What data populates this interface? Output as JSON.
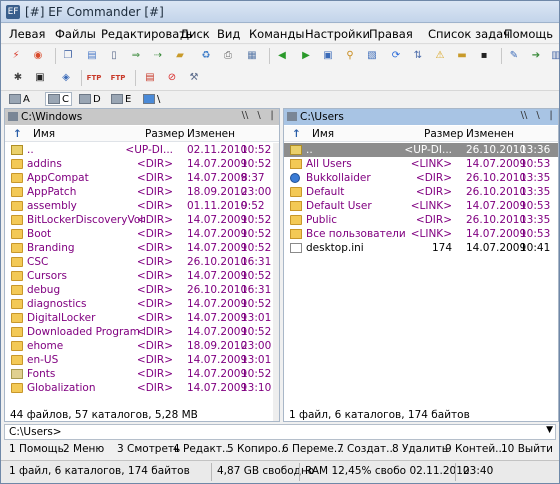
{
  "window": {
    "title": "[#] EF Commander [#]",
    "app_icon": "EF"
  },
  "menu": [
    "Левая",
    "Файлы",
    "Редактировать",
    "Диск",
    "Вид",
    "Команды",
    "Настройки",
    "Правая",
    "Список задач",
    "Помощь"
  ],
  "toolbar1_icons": [
    {
      "name": "lightning-icon",
      "glyph": "⚡",
      "color": "#d83a2a"
    },
    {
      "name": "stop-icon",
      "glyph": "◉",
      "color": "#d84a2a"
    },
    {
      "name": "copy-icon",
      "glyph": "❐",
      "color": "#4a6aa8"
    },
    {
      "name": "book-icon",
      "glyph": "▤",
      "color": "#4a7ac8"
    },
    {
      "name": "new-file-icon",
      "glyph": "▯",
      "color": "#5a6a8a"
    },
    {
      "name": "copy-files-icon",
      "glyph": "⇒",
      "color": "#3a8a3a"
    },
    {
      "name": "move-files-icon",
      "glyph": "⇢",
      "color": "#3a8a3a"
    },
    {
      "name": "new-folder-icon",
      "glyph": "▰",
      "color": "#c89a2a"
    },
    {
      "name": "delete-icon",
      "glyph": "♻",
      "color": "#3a7ac8"
    },
    {
      "name": "print-icon",
      "glyph": "⎙",
      "color": "#6a6a6a"
    },
    {
      "name": "properties-icon",
      "glyph": "▦",
      "color": "#5a7aa8"
    },
    {
      "name": "back-icon",
      "glyph": "◀",
      "color": "#2a9a2a"
    },
    {
      "name": "forward-icon",
      "glyph": "▶",
      "color": "#2a9a2a"
    },
    {
      "name": "filter-icon",
      "glyph": "▣",
      "color": "#3a6ab8"
    },
    {
      "name": "search-icon",
      "glyph": "⚲",
      "color": "#c88a1a"
    },
    {
      "name": "find-icon",
      "glyph": "▧",
      "color": "#3a6ab8"
    },
    {
      "name": "sync-icon",
      "glyph": "⟳",
      "color": "#2a6ad8"
    },
    {
      "name": "sort-icon",
      "glyph": "⇅",
      "color": "#4a6aa8"
    },
    {
      "name": "warning-icon",
      "glyph": "⚠",
      "color": "#d8a21a"
    },
    {
      "name": "folder-icon",
      "glyph": "▬",
      "color": "#c89a2a"
    },
    {
      "name": "console-icon",
      "glyph": "▪",
      "color": "#222222"
    },
    {
      "name": "edit-icon",
      "glyph": "✎",
      "color": "#3a6ab8"
    },
    {
      "name": "arrow-right-icon",
      "glyph": "➔",
      "color": "#3a8a3a"
    },
    {
      "name": "view-icon",
      "glyph": "▥",
      "color": "#4a6aa8"
    }
  ],
  "toolbar2_icons": [
    {
      "name": "network-icon",
      "glyph": "✱",
      "color": "#444444"
    },
    {
      "name": "terminal-icon",
      "glyph": "▣",
      "color": "#222222"
    },
    {
      "name": "cube-icon",
      "glyph": "◈",
      "color": "#3a6ab8"
    },
    {
      "name": "ftp-connect-icon",
      "glyph": "FTP",
      "color": "#c83a2a"
    },
    {
      "name": "ftp-disconnect-icon",
      "glyph": "FTP",
      "color": "#c83a2a"
    },
    {
      "name": "pack-icon",
      "glyph": "▤",
      "color": "#c83a2a"
    },
    {
      "name": "close-circle-icon",
      "glyph": "⊘",
      "color": "#d82a2a"
    },
    {
      "name": "tools-icon",
      "glyph": "⚒",
      "color": "#5a6a8a"
    }
  ],
  "drives": [
    "A",
    "C",
    "D",
    "E",
    "\\"
  ],
  "left_panel": {
    "path": "C:\\Windows",
    "col_name": "Имя",
    "col_size": "Размер",
    "col_date": "Изменен",
    "rows": [
      {
        "icon": "up",
        "name": "..",
        "size": "<UP-DI...",
        "date": "02.11.2010",
        "time": "10:52",
        "purple": true
      },
      {
        "icon": "folder",
        "name": "addins",
        "size": "<DIR>",
        "date": "14.07.2009",
        "time": "10:52",
        "purple": true
      },
      {
        "icon": "folder",
        "name": "AppCompat",
        "size": "<DIR>",
        "date": "14.07.2009",
        "time": "8:37",
        "purple": true
      },
      {
        "icon": "folder",
        "name": "AppPatch",
        "size": "<DIR>",
        "date": "18.09.2010",
        "time": "23:00",
        "purple": true
      },
      {
        "icon": "folder",
        "name": "assembly",
        "size": "<DIR>",
        "date": "01.11.2010",
        "time": "9:52",
        "purple": true
      },
      {
        "icon": "folder",
        "name": "BitLockerDiscoveryVolu...",
        "size": "<DIR>",
        "date": "14.07.2009",
        "time": "10:52",
        "purple": true
      },
      {
        "icon": "folder",
        "name": "Boot",
        "size": "<DIR>",
        "date": "14.07.2009",
        "time": "10:52",
        "purple": true
      },
      {
        "icon": "folder",
        "name": "Branding",
        "size": "<DIR>",
        "date": "14.07.2009",
        "time": "10:52",
        "purple": true
      },
      {
        "icon": "folder",
        "name": "CSC",
        "size": "<DIR>",
        "date": "26.10.2010",
        "time": "16:31",
        "purple": true
      },
      {
        "icon": "folder",
        "name": "Cursors",
        "size": "<DIR>",
        "date": "14.07.2009",
        "time": "10:52",
        "purple": true
      },
      {
        "icon": "folder",
        "name": "debug",
        "size": "<DIR>",
        "date": "26.10.2010",
        "time": "16:31",
        "purple": true
      },
      {
        "icon": "folder",
        "name": "diagnostics",
        "size": "<DIR>",
        "date": "14.07.2009",
        "time": "10:52",
        "purple": true
      },
      {
        "icon": "folder",
        "name": "DigitalLocker",
        "size": "<DIR>",
        "date": "14.07.2009",
        "time": "13:01",
        "purple": true
      },
      {
        "icon": "folder",
        "name": "Downloaded Program Files",
        "size": "<DIR>",
        "date": "14.07.2009",
        "time": "10:52",
        "purple": true
      },
      {
        "icon": "folder",
        "name": "ehome",
        "size": "<DIR>",
        "date": "18.09.2010",
        "time": "23:00",
        "purple": true
      },
      {
        "icon": "folder",
        "name": "en-US",
        "size": "<DIR>",
        "date": "14.07.2009",
        "time": "13:01",
        "purple": true
      },
      {
        "icon": "fonts",
        "name": "Fonts",
        "size": "<DIR>",
        "date": "14.07.2009",
        "time": "10:52",
        "purple": true
      },
      {
        "icon": "folder",
        "name": "Globalization",
        "size": "<DIR>",
        "date": "14.07.2009",
        "time": "13:10",
        "purple": true
      }
    ],
    "status": "44 файлов, 57 каталогов, 5,28 MB"
  },
  "right_panel": {
    "path": "C:\\Users",
    "col_name": "Имя",
    "col_size": "Размер",
    "col_date": "Изменен",
    "rows": [
      {
        "icon": "up",
        "name": "..",
        "size": "<UP-DI...",
        "date": "26.10.2010",
        "time": "13:36",
        "purple": false,
        "cursor": true
      },
      {
        "icon": "link",
        "name": "All Users",
        "size": "<LINK>",
        "date": "14.07.2009",
        "time": "10:53",
        "purple": true
      },
      {
        "icon": "user",
        "name": "Bukkollaider",
        "size": "<DIR>",
        "date": "26.10.2010",
        "time": "13:35",
        "purple": true
      },
      {
        "icon": "folder",
        "name": "Default",
        "size": "<DIR>",
        "date": "26.10.2010",
        "time": "13:35",
        "purple": true
      },
      {
        "icon": "link",
        "name": "Default User",
        "size": "<LINK>",
        "date": "14.07.2009",
        "time": "10:53",
        "purple": true
      },
      {
        "icon": "folder",
        "name": "Public",
        "size": "<DIR>",
        "date": "26.10.2010",
        "time": "13:35",
        "purple": true
      },
      {
        "icon": "link",
        "name": "Все пользователи",
        "size": "<LINK>",
        "date": "14.07.2009",
        "time": "10:53",
        "purple": true
      },
      {
        "icon": "file",
        "name": "desktop.ini",
        "size": "174",
        "date": "14.07.2009",
        "time": "10:41",
        "purple": false
      }
    ],
    "status": "1 файл, 6 каталогов, 174 байтов"
  },
  "cmdline": {
    "value": "C:\\Users>"
  },
  "fkeys": [
    "1 Помощь",
    "2 Меню",
    "3 Смотреть",
    "4 Редакт...",
    "5 Копиро...",
    "6 Переме...",
    "7 Создат...",
    "8 Удалить",
    "9 Контей...",
    "10 Выйти"
  ],
  "statusbar": {
    "selection": "1 файл, 6 каталогов, 174 байтов",
    "disk_free": "4,87 GB свободно",
    "ram": "RAM 12,45% свобо 02.11.2010",
    "time": "23:40"
  }
}
